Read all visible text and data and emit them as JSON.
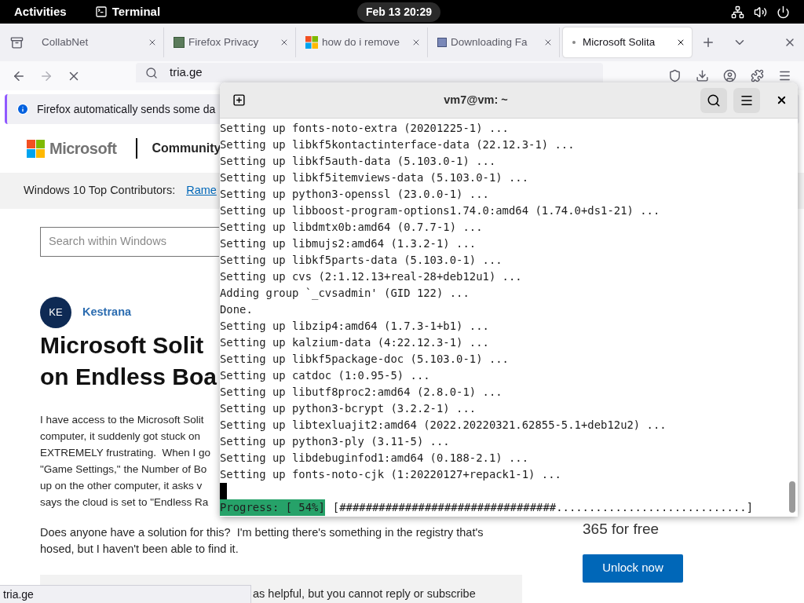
{
  "top_bar": {
    "activities": "Activities",
    "app_name": "Terminal",
    "clock": "Feb 13  20:29"
  },
  "browser": {
    "tabs": [
      {
        "title": "CollabNet",
        "kind": "plain",
        "selected": false
      },
      {
        "title": "Firefox Privacy",
        "kind": "page",
        "selected": false
      },
      {
        "title": "how do i remove",
        "kind": "windows",
        "selected": false
      },
      {
        "title": "Downloading Fa",
        "kind": "image",
        "selected": false
      },
      {
        "title": "Microsoft Solita",
        "kind": "loading",
        "selected": true
      }
    ],
    "url": "tria.ge",
    "notification": "Firefox automatically sends some da",
    "site": {
      "brand": "Microsoft",
      "section": "Community",
      "contributors_label": "Windows 10 Top Contributors:",
      "contributors_link": "Rame",
      "search_placeholder": "Search within Windows",
      "author_initials": "KE",
      "author_name": "Kestrana",
      "title_lines": [
        "Microsoft Solit",
        "on Endless Boa"
      ],
      "paragraph_lines": [
        "I have access to the Microsoft Solit",
        "computer, it suddenly got stuck on",
        "EXTREMELY frustrating.  When I go",
        "\"Game Settings,\" the Number of Bo",
        "up on the other computer, it asks v",
        "says the cloud is set to \"Endless Ra"
      ],
      "paragraph_2": "Does anyone have a solution for this?  I'm betting there's something in the registry that's hosed, but I haven't been able to find it.",
      "reply_note": "as helpful, but you cannot reply or subscribe",
      "promo_text": "365 for free",
      "promo_button": "Unlock now"
    },
    "status_url": "tria.ge"
  },
  "terminal": {
    "title": "vm7@vm: ~",
    "lines": [
      "Setting up fonts-noto-extra (20201225-1) ...",
      "Setting up libkf5kontactinterface-data (22.12.3-1) ...",
      "Setting up libkf5auth-data (5.103.0-1) ...",
      "Setting up libkf5itemviews-data (5.103.0-1) ...",
      "Setting up python3-openssl (23.0.0-1) ...",
      "Setting up libboost-program-options1.74.0:amd64 (1.74.0+ds1-21) ...",
      "Setting up libdmtx0b:amd64 (0.7.7-1) ...",
      "Setting up libmujs2:amd64 (1.3.2-1) ...",
      "Setting up libkf5parts-data (5.103.0-1) ...",
      "Setting up cvs (2:1.12.13+real-28+deb12u1) ...",
      "Adding group `_cvsadmin' (GID 122) ...",
      "Done.",
      "Setting up libzip4:amd64 (1.7.3-1+b1) ...",
      "Setting up kalzium-data (4:22.12.3-1) ...",
      "Setting up libkf5package-doc (5.103.0-1) ...",
      "Setting up catdoc (1:0.95-5) ...",
      "Setting up libutf8proc2:amd64 (2.8.0-1) ...",
      "Setting up python3-bcrypt (3.2.2-1) ...",
      "Setting up libtexluajit2:amd64 (2022.20220321.62855-5.1+deb12u2) ...",
      "Setting up python3-ply (3.11-5) ...",
      "Setting up libdebuginfod1:amd64 (0.188-2.1) ...",
      "Setting up fonts-noto-cjk (1:20220127+repack1-1) ..."
    ],
    "progress_label": "Progress: [ 54%]",
    "progress_bar": "[#################################.............................]"
  }
}
